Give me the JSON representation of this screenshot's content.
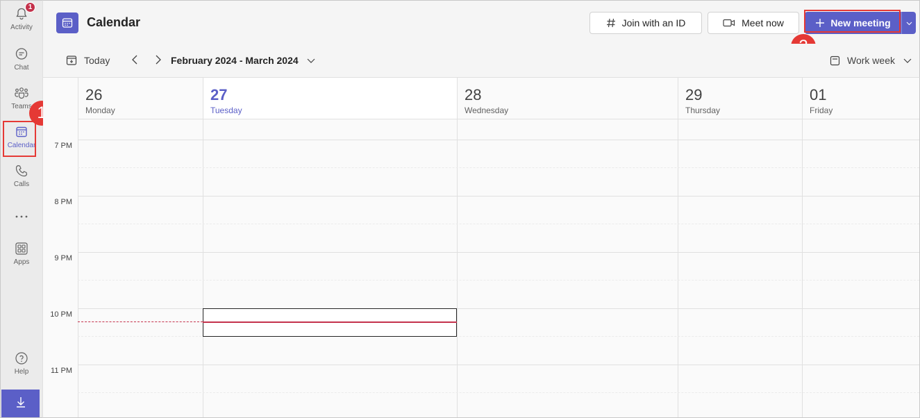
{
  "rail": {
    "items": [
      {
        "label": "Activity",
        "icon": "bell-icon",
        "badge": "1"
      },
      {
        "label": "Chat",
        "icon": "chat-icon"
      },
      {
        "label": "Teams",
        "icon": "teams-icon"
      },
      {
        "label": "Calendar",
        "icon": "calendar-icon"
      },
      {
        "label": "Calls",
        "icon": "phone-icon"
      },
      {
        "label": "Apps",
        "icon": "apps-icon"
      },
      {
        "label": "Help",
        "icon": "help-icon"
      }
    ]
  },
  "annotations": {
    "step1": "1",
    "step2": "2"
  },
  "header": {
    "title": "Calendar",
    "join_label": "Join with an ID",
    "meet_now_label": "Meet now",
    "new_meeting_label": "New meeting"
  },
  "toolbar": {
    "today_label": "Today",
    "date_range": "February 2024 - March 2024",
    "view_label": "Work week"
  },
  "days": [
    {
      "num": "26",
      "name": "Monday"
    },
    {
      "num": "27",
      "name": "Tuesday",
      "today": true
    },
    {
      "num": "28",
      "name": "Wednesday"
    },
    {
      "num": "29",
      "name": "Thursday"
    },
    {
      "num": "01",
      "name": "Friday"
    }
  ],
  "times": [
    "7 PM",
    "8 PM",
    "9 PM",
    "10 PM",
    "11 PM"
  ],
  "colors": {
    "accent": "#5b5fc7",
    "annotation": "#e53935",
    "now_line": "#c4314b"
  }
}
